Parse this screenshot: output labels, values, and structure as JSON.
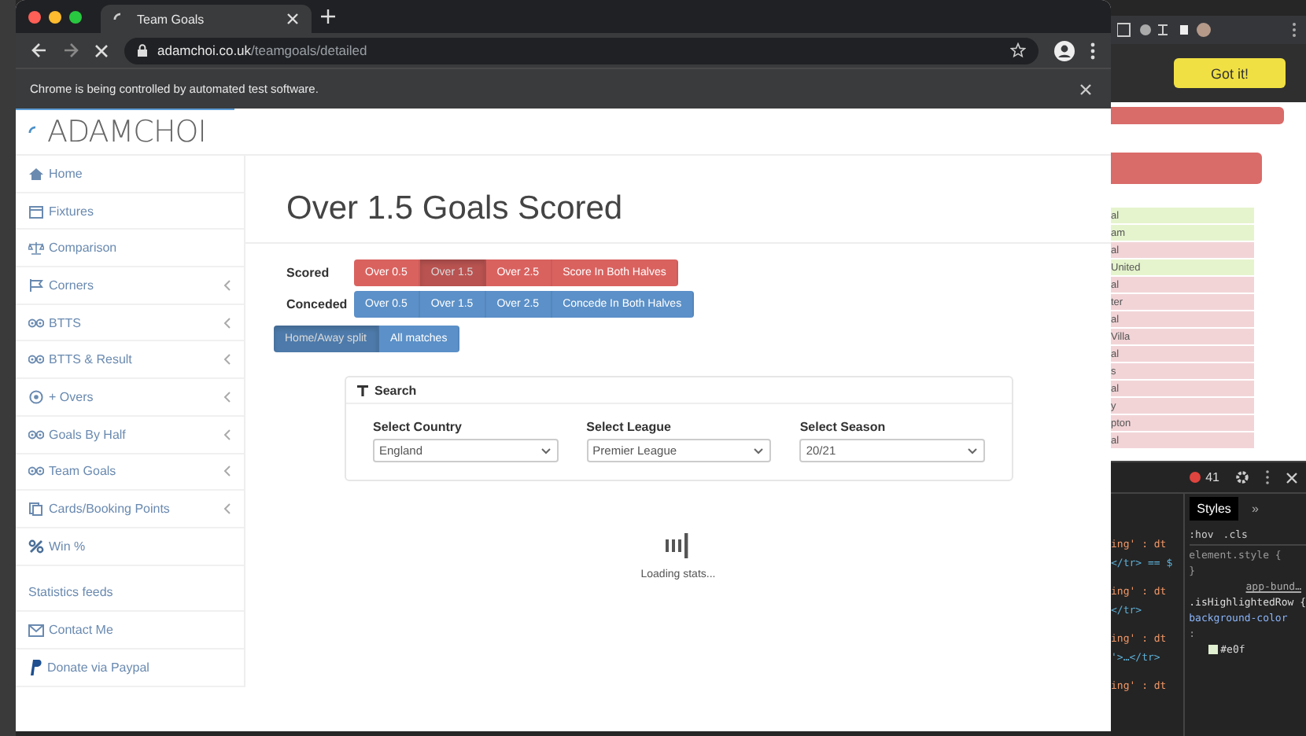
{
  "browser": {
    "tab_title": "Team Goals",
    "url_host": "adamchoi.co.uk",
    "url_path": "/teamgoals/detailed",
    "infobar_text": "Chrome is being controlled by automated test software.",
    "page_load": {
      "level": 0.2
    }
  },
  "site": {
    "logo": "ADAMCHOI"
  },
  "sidebar": {
    "items": [
      {
        "label": "Home",
        "expandable": false
      },
      {
        "label": "Fixtures",
        "expandable": false
      },
      {
        "label": "Comparison",
        "expandable": false
      },
      {
        "label": "Corners",
        "expandable": true
      },
      {
        "label": "BTTS",
        "expandable": true
      },
      {
        "label": "BTTS & Result",
        "expandable": true
      },
      {
        "label": "+ Overs",
        "expandable": true
      },
      {
        "label": "Goals By Half",
        "expandable": true
      },
      {
        "label": "Team Goals",
        "expandable": true
      },
      {
        "label": "Cards/Booking Points",
        "expandable": true
      },
      {
        "label": "Win %",
        "expandable": false
      }
    ],
    "footer_items": [
      {
        "label": "Statistics feeds"
      },
      {
        "label": "Contact Me"
      },
      {
        "label": "Donate via Paypal"
      }
    ]
  },
  "main": {
    "title": "Over 1.5 Goals Scored",
    "groups": [
      {
        "label": "Scored",
        "color": "#d9625f",
        "buttons": [
          {
            "label": "Over 0.5",
            "selected": false
          },
          {
            "label": "Over 1.5",
            "selected": true
          },
          {
            "label": "Over 2.5",
            "selected": false
          },
          {
            "label": "Score In Both Halves",
            "selected": false
          }
        ]
      },
      {
        "label": "Conceded",
        "color": "#5b90c8",
        "buttons": [
          {
            "label": "Over 0.5",
            "selected": false
          },
          {
            "label": "Over 1.5",
            "selected": false
          },
          {
            "label": "Over 2.5",
            "selected": false
          },
          {
            "label": "Concede In Both Halves",
            "selected": false
          }
        ]
      }
    ],
    "split": {
      "color": "#5b90c8",
      "buttons": [
        {
          "label": "Home/Away split",
          "selected": true
        },
        {
          "label": "All matches",
          "selected": false
        }
      ]
    },
    "search": {
      "title": "Search",
      "fields": [
        {
          "label": "Select Country",
          "value": "England"
        },
        {
          "label": "Select League",
          "value": "Premier League"
        },
        {
          "label": "Select Season",
          "value": "20/21"
        }
      ]
    },
    "loading": {
      "text": "Loading stats..."
    }
  },
  "background": {
    "got_it": "Got it!",
    "rows": [
      {
        "text": "al",
        "highlighted": true
      },
      {
        "text": "am",
        "highlighted": true
      },
      {
        "text": "al",
        "highlighted": false
      },
      {
        "text": "United",
        "highlighted": true
      },
      {
        "text": "al",
        "highlighted": false
      },
      {
        "text": "ter",
        "highlighted": false
      },
      {
        "text": "al",
        "highlighted": false
      },
      {
        "text": "Villa",
        "highlighted": false
      },
      {
        "text": "al",
        "highlighted": false
      },
      {
        "text": "s",
        "highlighted": false
      },
      {
        "text": "al",
        "highlighted": false
      },
      {
        "text": "y",
        "highlighted": false
      },
      {
        "text": "pton",
        "highlighted": false
      },
      {
        "text": "al",
        "highlighted": false
      }
    ],
    "devtools": {
      "error_count": "41",
      "tab": "Styles",
      "more": "»",
      "code_lines": [
        {
          "text": "ing' : dt",
          "kind": "attr"
        },
        {
          "text": "</tr> == $",
          "kind": "tag"
        },
        {
          "text": "ing' : dt",
          "kind": "attr"
        },
        {
          "text": "</tr>",
          "kind": "tag"
        },
        {
          "text": "ing' : dt",
          "kind": "attr"
        },
        {
          "text": "'>…</tr>",
          "kind": "tag"
        },
        {
          "text": "ing' : dt",
          "kind": "attr"
        }
      ],
      "filters": [
        ":hov",
        ".cls"
      ],
      "style_lines": [
        {
          "text": "element.style {",
          "kind": "plain"
        },
        {
          "text": "}",
          "kind": "plain"
        },
        {
          "text": "app-bund…",
          "kind": "link"
        },
        {
          "text": ".isHighlightedRow {",
          "kind": "selector"
        },
        {
          "text": "background-color",
          "kind": "prop"
        },
        {
          "text": ":",
          "kind": "plain"
        },
        {
          "text": "#e0f",
          "kind": "swatch"
        }
      ]
    }
  }
}
